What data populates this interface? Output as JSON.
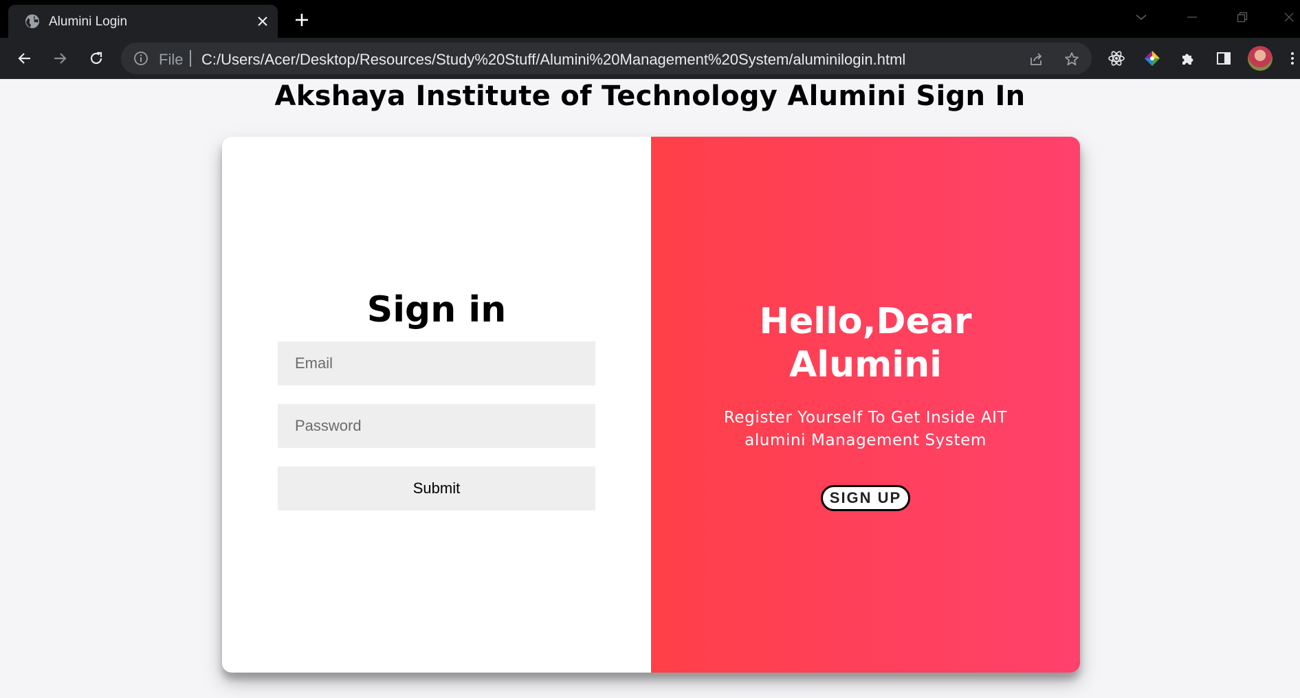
{
  "browser": {
    "tab": {
      "title": "Alumini Login",
      "favicon": "globe-icon"
    },
    "address_bar": {
      "scheme_label": "File",
      "url": "C:/Users/Acer/Desktop/Resources/Study%20Stuff/Alumini%20Management%20System/aluminilogin.html"
    },
    "icons": [
      "back-arrow-icon",
      "forward-arrow-icon",
      "reload-icon",
      "info-icon",
      "share-icon",
      "star-icon",
      "react-devtools-icon",
      "color-picker-extension-icon",
      "extensions-puzzle-icon",
      "side-panel-icon",
      "avatar",
      "menu-kebab-icon"
    ]
  },
  "page": {
    "heading": "Akshaya Institute of Technology Alumini Sign In",
    "signin": {
      "title": "Sign in",
      "email_placeholder": "Email",
      "password_placeholder": "Password",
      "submit_label": "Submit"
    },
    "overlay": {
      "title_line1": "Hello,Dear",
      "title_line2": "Alumini",
      "text_line1": "Register Yourself To Get Inside AIT",
      "text_line2": "alumini Management System",
      "signup_label": "SIGN UP"
    }
  },
  "colors": {
    "accent_gradient_start": "#ff4048",
    "accent_gradient_end": "#ff416c",
    "page_background": "#f5f5f7",
    "field_background": "#eeeeee"
  }
}
